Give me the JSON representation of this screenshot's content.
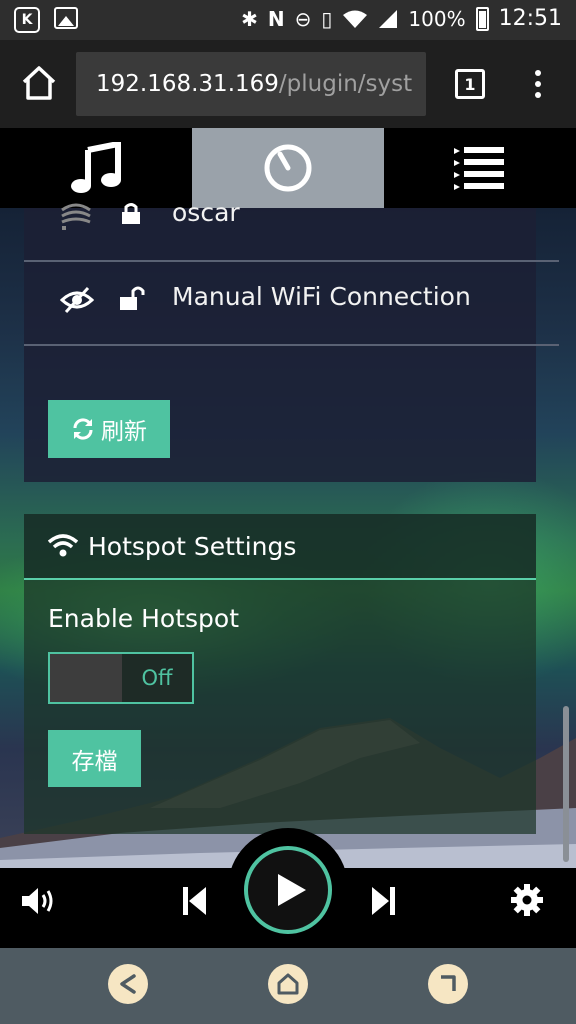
{
  "status_bar": {
    "app_icon": "K",
    "battery": "100%",
    "time": "12:51"
  },
  "browser": {
    "url_host": "192.168.31.169",
    "url_path": "/plugin/syst",
    "tab_count": "1"
  },
  "nav_tabs": [
    {
      "icon": "music-note-icon"
    },
    {
      "icon": "volume-dial-icon",
      "active": true
    },
    {
      "icon": "queue-list-icon"
    }
  ],
  "wifi_list": [
    {
      "name": "oscar"
    },
    {
      "name": "Manual WiFi Connection"
    }
  ],
  "refresh_label": "刷新",
  "hotspot": {
    "title": "Hotspot Settings",
    "enable_label": "Enable Hotspot",
    "toggle_state": "Off",
    "save_label": "存檔"
  },
  "colors": {
    "accent": "#4fc3a1",
    "active_tab": "#9aa2aa",
    "android_nav": "#4f5b62"
  }
}
